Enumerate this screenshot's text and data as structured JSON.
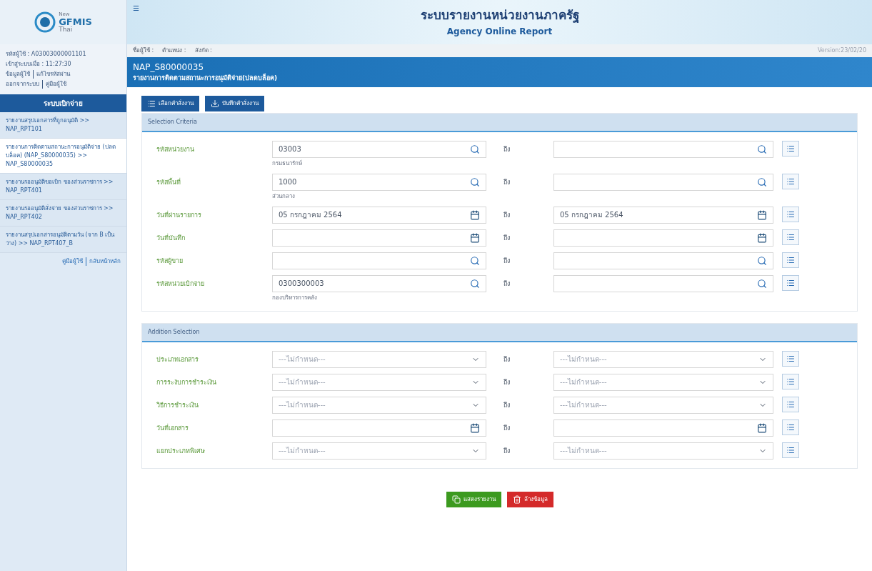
{
  "logo": {
    "small": "New",
    "name": "GFMIS",
    "sub": "Thai"
  },
  "user_info": [
    "รหัสผู้ใช้ : A03003000001101",
    "เข้าสู่ระบบเมื่อ : 11:27:30"
  ],
  "user_links": [
    [
      "ข้อมูลผู้ใช้",
      "แก้ไขรหัสผ่าน"
    ],
    [
      "ออกจากระบบ",
      "คู่มือผู้ใช้"
    ]
  ],
  "sidebar": {
    "title": "ระบบเบิกจ่าย",
    "items": [
      {
        "label": "รายงานสรุปเอกสารที่ถูกอนุมัติ >> NAP_RPT101",
        "selected": false
      },
      {
        "label": "รายงานการติดตามสถานะการอนุมัติจ่าย (ปลดบล็อค) (NAP_S80000035) >> NAP_S80000035",
        "selected": true
      },
      {
        "label": "รายงานรออนุมัติขอเบิก ของส่วนราชการ >> NAP_RPT401",
        "selected": false
      },
      {
        "label": "รายงานรออนุมัติสั่งจ่าย ของส่วนราชการ >> NAP_RPT402",
        "selected": false
      },
      {
        "label": "รายงานสรุปเอกสารอนุมัติตามวัน (จาก B เป็น ว่าง) >> NAP_RPT407_B",
        "selected": false
      }
    ],
    "footer_links": [
      "คู่มือผู้ใช้",
      "กลับหน้าหลัก"
    ]
  },
  "header": {
    "menu_glyph": "☰",
    "title": "ระบบรายงานหน่วยงานภาครัฐ",
    "subtitle": "Agency Online Report"
  },
  "user_bar": {
    "fields": [
      "ชื่อผู้ใช้ :",
      "ตำแหน่ง :",
      "สังกัด :"
    ],
    "version": "Version:23/02/20"
  },
  "page": {
    "code": "NAP_S80000035",
    "title": "รายงานการติดตามสถานะการอนุมัติจ่าย(ปลดบล็อค)"
  },
  "toolbar": [
    "เลือกคำสั่งงาน",
    "บันทึกคำสั่งงาน"
  ],
  "sections": [
    {
      "title": "Selection Criteria",
      "rows": [
        {
          "label": "รหัสหน่วยงาน",
          "kind": "search",
          "from": "03003",
          "note": "กรมธนารักษ์",
          "to_label": "ถึง",
          "to": ""
        },
        {
          "label": "รหัสพื้นที่",
          "kind": "search",
          "from": "1000",
          "note": "ส่วนกลาง",
          "to_label": "ถึง",
          "to": ""
        },
        {
          "label": "วันที่ผ่านรายการ",
          "kind": "date",
          "from": "05 กรกฎาคม 2564",
          "to_label": "ถึง",
          "to": "05 กรกฎาคม 2564"
        },
        {
          "label": "วันที่บันทึก",
          "kind": "date",
          "from": "",
          "to_label": "ถึง",
          "to": ""
        },
        {
          "label": "รหัสผู้ขาย",
          "kind": "search",
          "from": "",
          "to_label": "ถึง",
          "to": ""
        },
        {
          "label": "รหัสหน่วยเบิกจ่าย",
          "kind": "search",
          "from": "0300300003",
          "note": "กองบริหารการคลัง",
          "to_label": "ถึง",
          "to": ""
        }
      ]
    },
    {
      "title": "Addition Selection",
      "rows": [
        {
          "label": "ประเภทเอกสาร",
          "kind": "select",
          "from": "---ไม่กำหนด---",
          "to_label": "ถึง",
          "to": "---ไม่กำหนด---"
        },
        {
          "label": "การระงับการชำระเงิน",
          "kind": "select",
          "from": "---ไม่กำหนด---",
          "to_label": "ถึง",
          "to": "---ไม่กำหนด---"
        },
        {
          "label": "วิธีการชำระเงิน",
          "kind": "select",
          "from": "---ไม่กำหนด---",
          "to_label": "ถึง",
          "to": "---ไม่กำหนด---"
        },
        {
          "label": "วันที่เอกสาร",
          "kind": "date",
          "from": "",
          "to_label": "ถึง",
          "to": ""
        },
        {
          "label": "แยกประเภทพิเศษ",
          "kind": "select",
          "from": "---ไม่กำหนด---",
          "to_label": "ถึง",
          "to": "---ไม่กำหนด---"
        }
      ]
    }
  ],
  "actions": [
    {
      "label": "แสดงรายงาน",
      "kind": "primary"
    },
    {
      "label": "ล้างข้อมูล",
      "kind": "danger"
    }
  ]
}
